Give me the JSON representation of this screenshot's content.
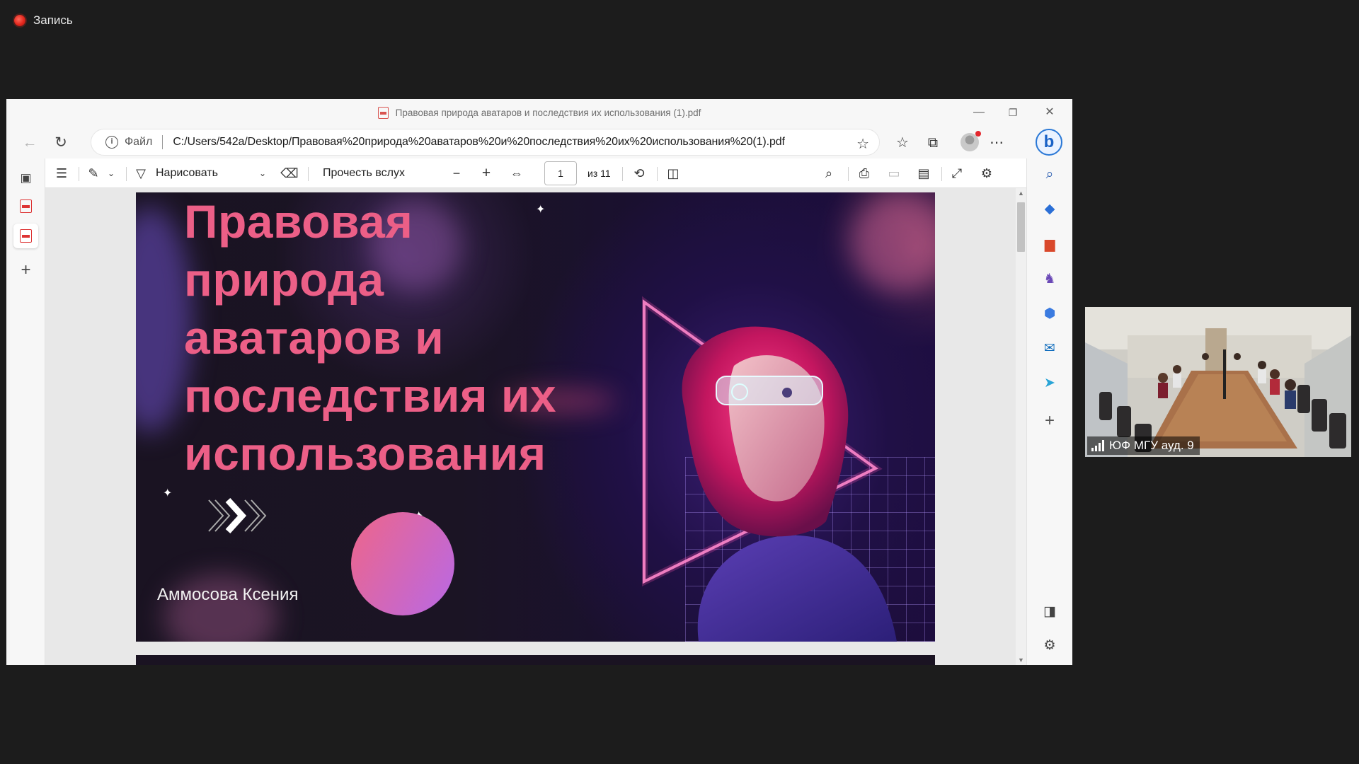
{
  "recording": {
    "label": "Запись"
  },
  "window": {
    "title": "Правовая природа аватаров и последствия их использования (1).pdf",
    "controls": {
      "minimize": "—",
      "restore": "❐",
      "close": "✕"
    }
  },
  "address_bar": {
    "site_label": "Файл",
    "url": "C:/Users/542a/Desktop/Правовая%20природа%20аватаров%20и%20последствия%20их%20использования%20(1).pdf"
  },
  "pdf_toolbar": {
    "draw_label": "Нарисовать",
    "read_aloud_label": "Прочесть вслух",
    "current_page": "1",
    "page_total": "из 11"
  },
  "slide": {
    "title_lines": [
      "Правовая",
      "природа",
      "аватаров и",
      "последствия их",
      "использования"
    ],
    "author": "Аммосова Ксения"
  },
  "video": {
    "participant": "ЮФ МГУ ауд. 9"
  },
  "colors": {
    "title_pink": "#ec5f87",
    "accent_blue": "#2a78d6",
    "record_red": "#e2261c"
  }
}
